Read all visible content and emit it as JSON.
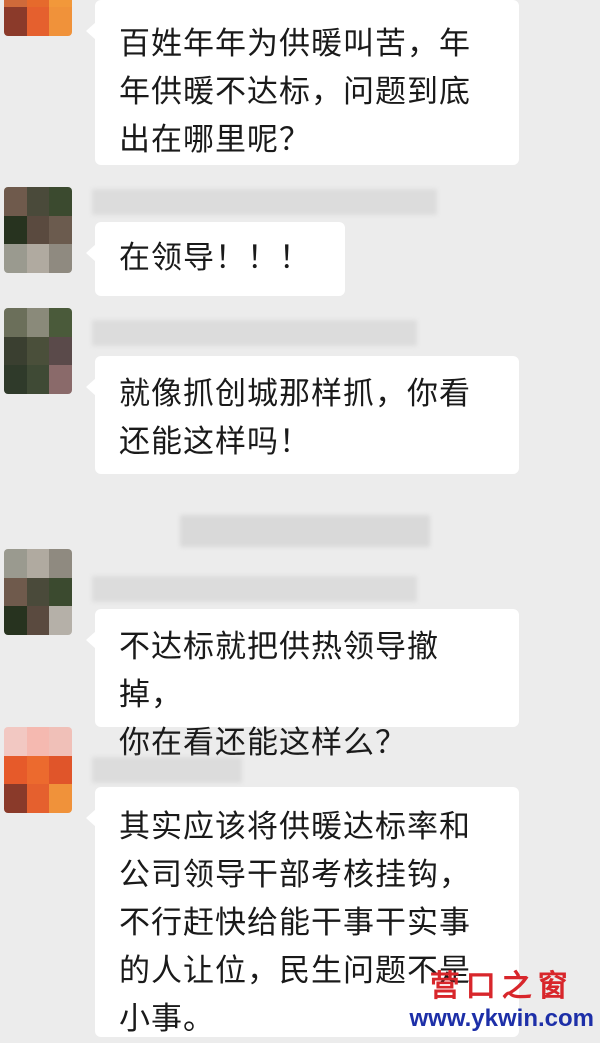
{
  "messages": [
    {
      "text": "百姓年年为供暖叫苦，年\n年供暖不达标，问题到底\n出在哪里呢？"
    },
    {
      "text": "在领导！！！"
    },
    {
      "text": "就像抓创城那样抓，你看\n还能这样吗！"
    },
    {
      "text": "不达标就把供热领导撤掉，\n你在看还能这样么？"
    },
    {
      "text": "其实应该将供暖达标率和\n公司领导干部考核挂钩，\n不行赶快给能干事干实事\n的人让位，民生问题不是\n小事。"
    }
  ],
  "watermark": {
    "title": "营口之窗",
    "url": "www.ykwin.com"
  },
  "colors": {
    "background": "#ececec",
    "bubble": "#ffffff",
    "watermark_red": "#d8262b",
    "watermark_blue": "#1d2fa8"
  }
}
